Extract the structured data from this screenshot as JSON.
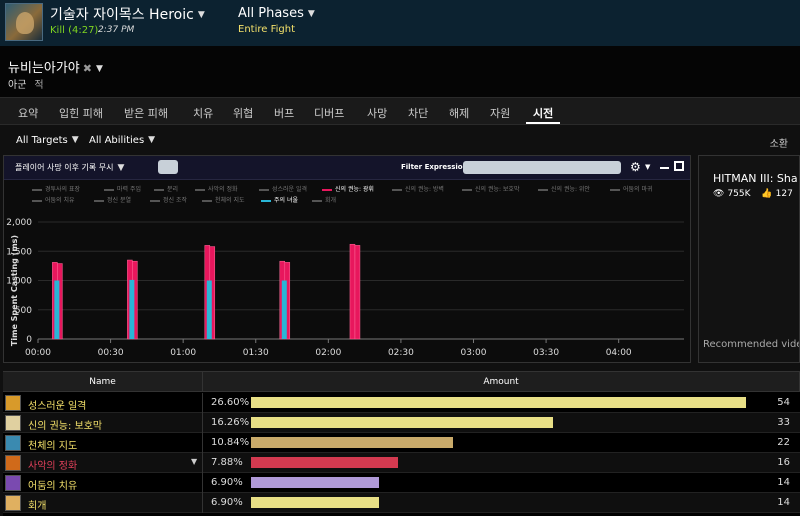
{
  "header": {
    "boss_name": "기술자 자이목스 Heroic",
    "kill_label": "Kill (4:27)",
    "kill_time": "2:37 PM",
    "phases_label": "All Phases",
    "phases_sub": "Entire Fight"
  },
  "player": {
    "name": "뉴비는아가야",
    "tag_friendly": "아군",
    "tag_enemy": "적"
  },
  "tabs": [
    "요약",
    "입힌 피해",
    "받은 피해",
    "치유",
    "위협",
    "버프",
    "디버프",
    "사망",
    "차단",
    "해제",
    "자원",
    "시전"
  ],
  "active_tab": "시전",
  "filters": {
    "targets": "All Targets",
    "abilities": "All Abilities",
    "right_label": "소환"
  },
  "graph": {
    "death_filter": "플레이어 사망 이후 기록 무시",
    "filter_expression_label": "Filter Expression:",
    "filter_expression_value": "",
    "legend": [
      {
        "label": "경투사의 표장",
        "color": "#555555",
        "on": false
      },
      {
        "label": "마력 주입",
        "color": "#555555",
        "on": false
      },
      {
        "label": "분리",
        "color": "#555555",
        "on": false
      },
      {
        "label": "사악의 정화",
        "color": "#555555",
        "on": false
      },
      {
        "label": "성스러운 일격",
        "color": "#555555",
        "on": false
      },
      {
        "label": "신의 권능: 광휘",
        "color": "#e8175d",
        "on": true
      },
      {
        "label": "신의 권능: 방벽",
        "color": "#555555",
        "on": false
      },
      {
        "label": "신의 권능: 보호막",
        "color": "#555555",
        "on": false
      },
      {
        "label": "신의 권능: 위안",
        "color": "#555555",
        "on": false
      },
      {
        "label": "어둠의 마귀",
        "color": "#555555",
        "on": false
      },
      {
        "label": "어둠의 치유",
        "color": "#555555",
        "on": false
      },
      {
        "label": "정신 분열",
        "color": "#555555",
        "on": false
      },
      {
        "label": "정신 조작",
        "color": "#555555",
        "on": false
      },
      {
        "label": "천체의 지도",
        "color": "#555555",
        "on": false
      },
      {
        "label": "주의 녀울",
        "color": "#29b6d6",
        "on": true
      },
      {
        "label": "회개",
        "color": "#555555",
        "on": false
      }
    ]
  },
  "chart_data": {
    "type": "bar",
    "ylabel": "Time Spent Casting (ms)",
    "xlabel": "",
    "ylim": [
      0,
      2000
    ],
    "yticks": [
      "0",
      "500",
      "1,000",
      "1,500",
      "2,000"
    ],
    "xticks": [
      "00:00",
      "00:30",
      "01:00",
      "01:30",
      "02:00",
      "02:30",
      "03:00",
      "03:30",
      "04:00"
    ],
    "xticks_seconds": [
      0,
      30,
      60,
      90,
      120,
      150,
      180,
      210,
      240
    ],
    "x_max_seconds": 267,
    "series": [
      {
        "name": "신의 권능: 광휘",
        "color": "#e8175d",
        "points": [
          [
            8,
            1310
          ],
          [
            39,
            1350
          ],
          [
            71,
            1600
          ],
          [
            102,
            1330
          ],
          [
            131,
            1620
          ]
        ]
      },
      {
        "name": "주의 녀울",
        "color": "#29b6d6",
        "points": [
          [
            8,
            1000
          ],
          [
            39,
            1010
          ],
          [
            71,
            1000
          ],
          [
            102,
            1000
          ]
        ]
      }
    ]
  },
  "ad": {
    "title": "HITMAN III: Sha",
    "views": "755K",
    "likes": "127",
    "recommended": "Recommended video"
  },
  "table": {
    "headers": [
      "Name",
      "Amount"
    ],
    "rows": [
      {
        "name": "성스러운 일격",
        "name_color": "#f3e06a",
        "icon_color": "#d89a2a",
        "pct": "26.60%",
        "fraction": 1.0,
        "bar_color": "#e8df86",
        "count": "54"
      },
      {
        "name": "신의 권능: 보호막",
        "name_color": "#f3e06a",
        "icon_color": "#e0d0a0",
        "pct": "16.26%",
        "fraction": 0.611,
        "bar_color": "#e8df86",
        "count": "33"
      },
      {
        "name": "천체의 지도",
        "name_color": "#f3e06a",
        "icon_color": "#3a8ab0",
        "pct": "10.84%",
        "fraction": 0.408,
        "bar_color": "#c9aa6a",
        "count": "22"
      },
      {
        "name": "사악의 정화",
        "name_color": "#e0405a",
        "icon_color": "#d06a1a",
        "pct": "7.88%",
        "fraction": 0.296,
        "bar_color": "#d33a50",
        "count": "16",
        "caret": true
      },
      {
        "name": "어둠의 치유",
        "name_color": "#f3e06a",
        "icon_color": "#7a4ab0",
        "pct": "6.90%",
        "fraction": 0.259,
        "bar_color": "#b09ad8",
        "count": "14"
      },
      {
        "name": "회개",
        "name_color": "#f3e06a",
        "icon_color": "#e0b060",
        "pct": "6.90%",
        "fraction": 0.259,
        "bar_color": "#e8df86",
        "count": "14"
      }
    ]
  }
}
